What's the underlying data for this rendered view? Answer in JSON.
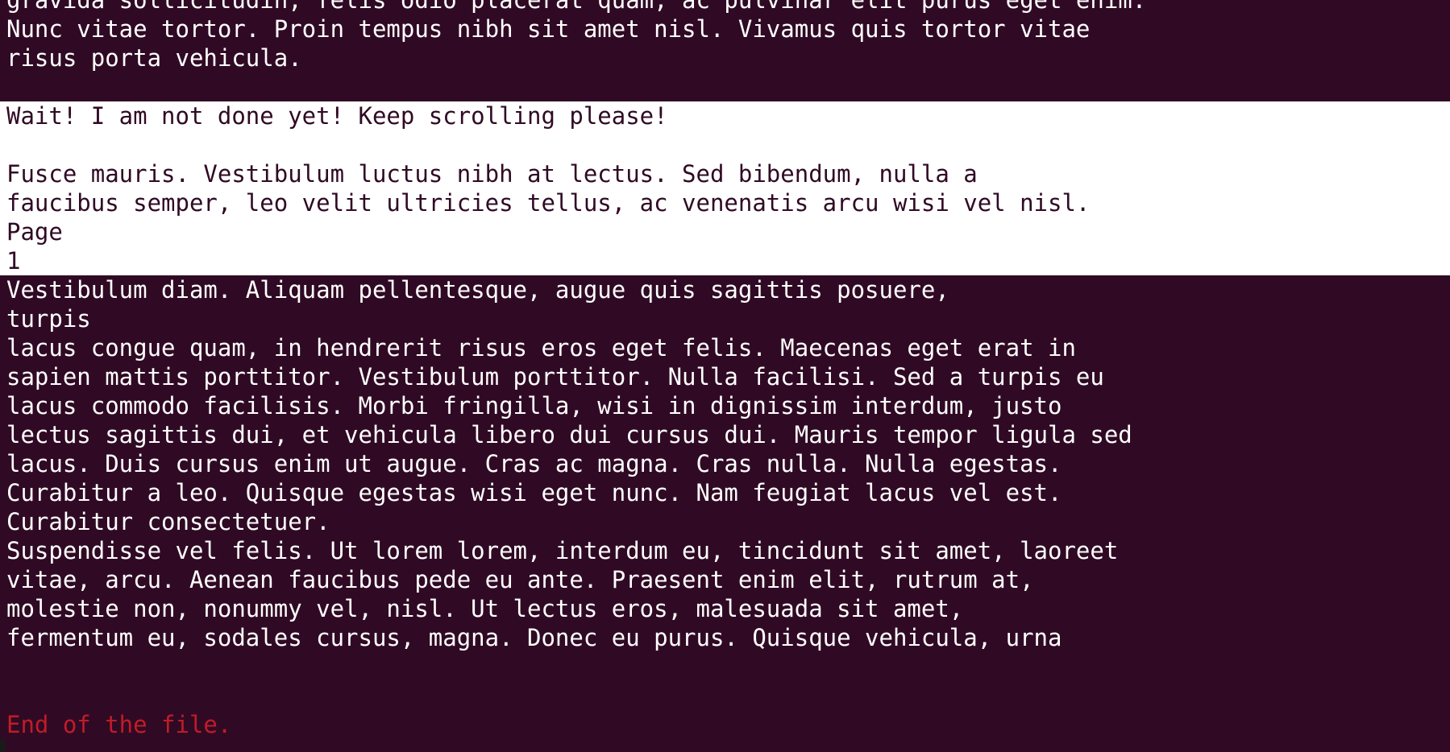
{
  "terminal": {
    "colors": {
      "background": "#300a24",
      "foreground": "#ffffff",
      "highlight_background": "#ffffff",
      "highlight_foreground": "#300a24",
      "error_text": "#c01c28"
    },
    "lines": [
      {
        "text": "gravida sollicitudin, felis odio placerat quam, ac pulvinar elit purus eget enim.",
        "style": "dark"
      },
      {
        "text": "Nunc vitae tortor. Proin tempus nibh sit amet nisl. Vivamus quis tortor vitae",
        "style": "dark"
      },
      {
        "text": "risus porta vehicula.",
        "style": "dark"
      },
      {
        "text": "",
        "style": "dark"
      },
      {
        "text": "Wait! I am not done yet! Keep scrolling please!",
        "style": "light"
      },
      {
        "text": "",
        "style": "light"
      },
      {
        "text": "Fusce mauris. Vestibulum luctus nibh at lectus. Sed bibendum, nulla a",
        "style": "light"
      },
      {
        "text": "faucibus semper, leo velit ultricies tellus, ac venenatis arcu wisi vel nisl.",
        "style": "light"
      },
      {
        "text": "Page",
        "style": "light"
      },
      {
        "text": "1",
        "style": "light"
      },
      {
        "text": "Vestibulum diam. Aliquam pellentesque, augue quis sagittis posuere,",
        "style": "dark"
      },
      {
        "text": "turpis",
        "style": "dark"
      },
      {
        "text": "lacus congue quam, in hendrerit risus eros eget felis. Maecenas eget erat in",
        "style": "dark"
      },
      {
        "text": "sapien mattis porttitor. Vestibulum porttitor. Nulla facilisi. Sed a turpis eu",
        "style": "dark"
      },
      {
        "text": "lacus commodo facilisis. Morbi fringilla, wisi in dignissim interdum, justo",
        "style": "dark"
      },
      {
        "text": "lectus sagittis dui, et vehicula libero dui cursus dui. Mauris tempor ligula sed",
        "style": "dark"
      },
      {
        "text": "lacus. Duis cursus enim ut augue. Cras ac magna. Cras nulla. Nulla egestas.",
        "style": "dark"
      },
      {
        "text": "Curabitur a leo. Quisque egestas wisi eget nunc. Nam feugiat lacus vel est.",
        "style": "dark"
      },
      {
        "text": "Curabitur consectetuer.",
        "style": "dark"
      },
      {
        "text": "Suspendisse vel felis. Ut lorem lorem, interdum eu, tincidunt sit amet, laoreet",
        "style": "dark"
      },
      {
        "text": "vitae, arcu. Aenean faucibus pede eu ante. Praesent enim elit, rutrum at,",
        "style": "dark"
      },
      {
        "text": "molestie non, nonummy vel, nisl. Ut lectus eros, malesuada sit amet,",
        "style": "dark"
      },
      {
        "text": "fermentum eu, sodales cursus, magna. Donec eu purus. Quisque vehicula, urna",
        "style": "dark"
      },
      {
        "text": "",
        "style": "dark"
      },
      {
        "text": "",
        "style": "dark"
      },
      {
        "text": "End of the file.",
        "style": "red"
      }
    ]
  }
}
